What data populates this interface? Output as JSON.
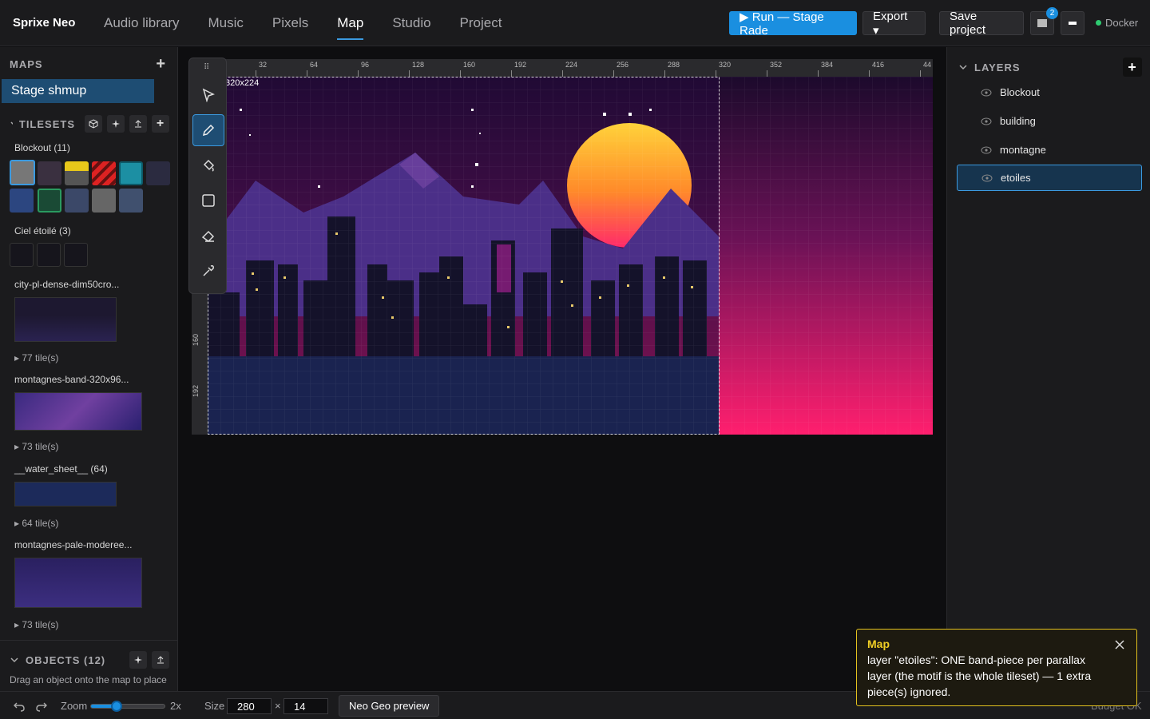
{
  "app": {
    "title": "Sprixe Neo"
  },
  "nav": {
    "tabs": [
      {
        "label": "Audio library"
      },
      {
        "label": "Music"
      },
      {
        "label": "Pixels"
      },
      {
        "label": "Map",
        "active": true
      },
      {
        "label": "Studio"
      },
      {
        "label": "Project"
      }
    ]
  },
  "actions": {
    "run_label": "▶ Run — Stage Rade",
    "export_label": "Export ▾",
    "save_label": "Save project",
    "notif_count": "2",
    "docker_label": "Docker",
    "docker_color": "#2ecc71"
  },
  "maps": {
    "header": "MAPS",
    "items": [
      {
        "label": "Stage shmup",
        "selected": true
      }
    ]
  },
  "tilesets": {
    "header": "TILESETS",
    "groups": [
      {
        "title": "Blockout (11)"
      },
      {
        "title": "Ciel étoilé (3)"
      },
      {
        "title": "city-pl-dense-dim50cro...",
        "count": "▸ 77 tile(s)"
      },
      {
        "title": "montagnes-band-320x96...",
        "count": "▸ 73 tile(s)"
      },
      {
        "title": "__water_sheet__ (64)",
        "count": "▸ 64 tile(s)"
      },
      {
        "title": "montagnes-pale-moderee...",
        "count": "▸ 73 tile(s)"
      }
    ]
  },
  "objects": {
    "header": "OBJECTS (12)",
    "hint": "Drag an object onto the map to place"
  },
  "canvas": {
    "size_label": "320x224",
    "ruler_x": [
      "32",
      "64",
      "96",
      "128",
      "160",
      "192",
      "224",
      "256",
      "288",
      "320",
      "352",
      "384",
      "416",
      "44"
    ],
    "ruler_y": [
      "160",
      "192"
    ]
  },
  "layers": {
    "header": "LAYERS",
    "items": [
      {
        "label": "Blockout"
      },
      {
        "label": "building"
      },
      {
        "label": "montagne"
      },
      {
        "label": "etoiles",
        "selected": true
      }
    ]
  },
  "statusbar": {
    "zoom_label": "Zoom",
    "zoom_value": "2x",
    "zoom_level": 0.34,
    "size_label": "Size",
    "width": "280",
    "times": "×",
    "height": "14",
    "preview_label": "Neo Geo preview",
    "budget_label": "Budget OK"
  },
  "toast": {
    "title": "Map",
    "message": "layer \"etoiles\": ONE band-piece per parallax layer (the motif is the whole tileset) — 1 extra piece(s) ignored.",
    "accent": "#f1cf25"
  }
}
